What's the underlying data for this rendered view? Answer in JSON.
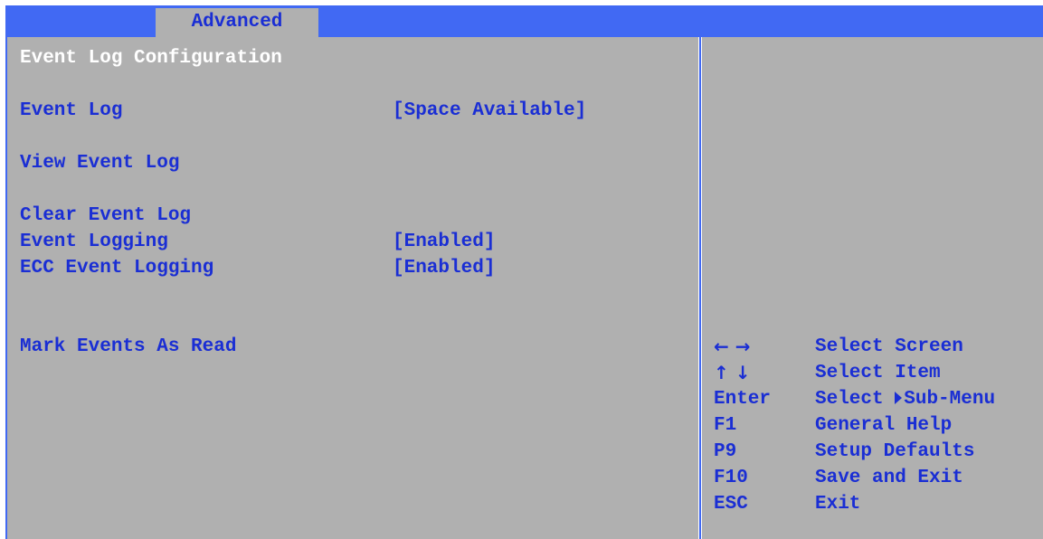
{
  "header": {
    "active_tab": "Advanced"
  },
  "main": {
    "section_title": "Event Log Configuration",
    "items": [
      {
        "label": "Event Log",
        "value": "[Space Available]"
      },
      {
        "label": "View Event Log",
        "value": ""
      },
      {
        "label": "Clear Event Log",
        "value": ""
      },
      {
        "label": "Event Logging",
        "value": "[Enabled]"
      },
      {
        "label": "ECC Event Logging",
        "value": "[Enabled]"
      },
      {
        "label": "Mark Events As Read",
        "value": ""
      }
    ]
  },
  "help": {
    "keys": [
      {
        "key": "← →",
        "desc": "Select Screen"
      },
      {
        "key": "↑ ↓",
        "desc": "Select Item"
      },
      {
        "key": "Enter",
        "desc_pre": "Select",
        "desc_post": "Sub-Menu",
        "icon": "triangle-right-icon"
      },
      {
        "key": "F1",
        "desc": "General Help"
      },
      {
        "key": "P9",
        "desc": "Setup Defaults"
      },
      {
        "key": "F10",
        "desc": "Save and Exit"
      },
      {
        "key": "ESC",
        "desc": "Exit"
      }
    ]
  },
  "colors": {
    "blue_bar": "#4169f3",
    "panel_gray": "#b0b0b0",
    "text_blue": "#1a2ed4",
    "title_white": "#ffffff"
  }
}
